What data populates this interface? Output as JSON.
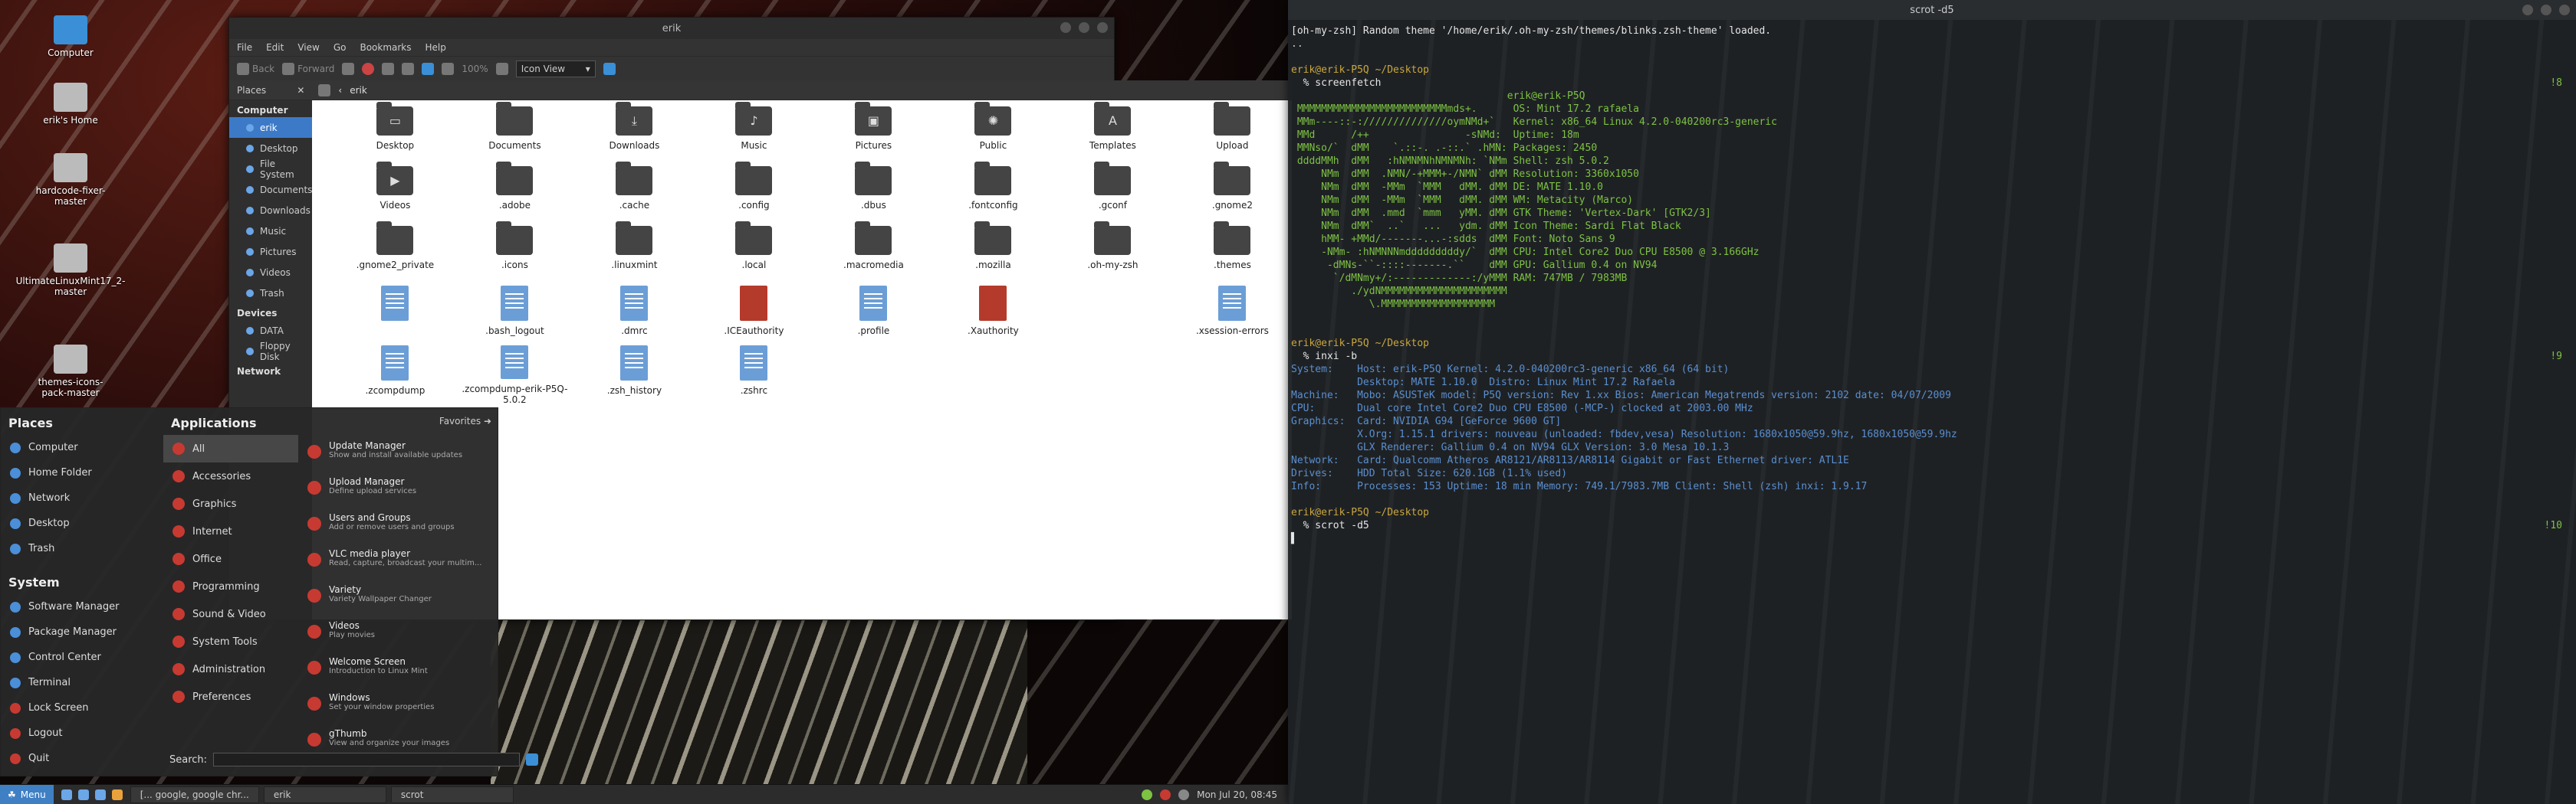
{
  "desktop_icons": [
    {
      "label": "Computer",
      "icon": "monitor-icon"
    },
    {
      "label": "erik's Home",
      "icon": "home-icon"
    },
    {
      "label": "hardcode-fixer-master",
      "icon": "drive-icon"
    },
    {
      "label": "UltimateLinuxMint17_2-master",
      "icon": "drive-icon"
    },
    {
      "label": "themes-icons-pack-master",
      "icon": "drive-icon"
    }
  ],
  "fm": {
    "title": "erik",
    "menu": [
      "File",
      "Edit",
      "View",
      "Go",
      "Bookmarks",
      "Help"
    ],
    "back": "Back",
    "forward": "Forward",
    "zoom": "100%",
    "view_mode": "Icon View",
    "places_label": "Places",
    "path_label": "erik",
    "sidebar": {
      "computer_label": "Computer",
      "computer": [
        "erik",
        "Desktop",
        "File System",
        "Documents",
        "Downloads",
        "Music",
        "Pictures",
        "Videos",
        "Trash"
      ],
      "devices_label": "Devices",
      "devices": [
        "DATA",
        "Floppy Disk"
      ],
      "network_label": "Network"
    },
    "files": [
      {
        "name": "Desktop",
        "kind": "folder",
        "glyph": "▭"
      },
      {
        "name": "Documents",
        "kind": "folder",
        "glyph": ""
      },
      {
        "name": "Downloads",
        "kind": "folder",
        "glyph": "⤓"
      },
      {
        "name": "Music",
        "kind": "folder",
        "glyph": "♪"
      },
      {
        "name": "Pictures",
        "kind": "folder",
        "glyph": "▣"
      },
      {
        "name": "Public",
        "kind": "folder",
        "glyph": "✺"
      },
      {
        "name": "Templates",
        "kind": "folder",
        "glyph": "A"
      },
      {
        "name": "Upload",
        "kind": "folder",
        "glyph": ""
      },
      {
        "name": "Videos",
        "kind": "folder",
        "glyph": "▶"
      },
      {
        "name": ".adobe",
        "kind": "folder",
        "glyph": ""
      },
      {
        "name": ".cache",
        "kind": "folder",
        "glyph": ""
      },
      {
        "name": ".config",
        "kind": "folder",
        "glyph": ""
      },
      {
        "name": ".dbus",
        "kind": "folder",
        "glyph": ""
      },
      {
        "name": ".fontconfig",
        "kind": "folder",
        "glyph": ""
      },
      {
        "name": ".gconf",
        "kind": "folder",
        "glyph": ""
      },
      {
        "name": ".gnome2",
        "kind": "folder",
        "glyph": ""
      },
      {
        "name": ".gnome2_private",
        "kind": "folder",
        "glyph": ""
      },
      {
        "name": ".icons",
        "kind": "folder",
        "glyph": ""
      },
      {
        "name": ".linuxmint",
        "kind": "folder",
        "glyph": ""
      },
      {
        "name": ".local",
        "kind": "folder",
        "glyph": ""
      },
      {
        "name": ".macromedia",
        "kind": "folder",
        "glyph": ""
      },
      {
        "name": ".mozilla",
        "kind": "folder",
        "glyph": ""
      },
      {
        "name": ".oh-my-zsh",
        "kind": "folder",
        "glyph": ""
      },
      {
        "name": ".themes",
        "kind": "folder",
        "glyph": ""
      },
      {
        "name": "",
        "kind": "doc",
        "glyph": ""
      },
      {
        "name": ".bash_logout",
        "kind": "doc",
        "glyph": ""
      },
      {
        "name": ".dmrc",
        "kind": "doc",
        "glyph": ""
      },
      {
        "name": ".ICEauthority",
        "kind": "doc-red",
        "glyph": ""
      },
      {
        "name": ".profile",
        "kind": "doc",
        "glyph": ""
      },
      {
        "name": ".Xauthority",
        "kind": "doc-red",
        "glyph": ""
      },
      {
        "name": "",
        "kind": "blank",
        "glyph": ""
      },
      {
        "name": ".xsession-errors",
        "kind": "doc",
        "glyph": ""
      },
      {
        "name": ".zcompdump",
        "kind": "doc",
        "glyph": ""
      },
      {
        "name": ".zcompdump-erik-P5Q-5.0.2",
        "kind": "doc",
        "glyph": ""
      },
      {
        "name": ".zsh_history",
        "kind": "doc",
        "glyph": ""
      },
      {
        "name": ".zshrc",
        "kind": "doc",
        "glyph": ""
      }
    ]
  },
  "menu": {
    "places_title": "Places",
    "places": [
      "Computer",
      "Home Folder",
      "Network",
      "Desktop",
      "Trash"
    ],
    "system_title": "System",
    "system": [
      "Software Manager",
      "Package Manager",
      "Control Center",
      "Terminal",
      "Lock Screen",
      "Logout",
      "Quit"
    ],
    "apps_title": "Applications",
    "favorites": "Favorites",
    "categories": [
      "All",
      "Accessories",
      "Graphics",
      "Internet",
      "Office",
      "Programming",
      "Sound & Video",
      "System Tools",
      "Administration",
      "Preferences"
    ],
    "apps": [
      {
        "name": "Update Manager",
        "desc": "Show and install available updates"
      },
      {
        "name": "Upload Manager",
        "desc": "Define upload services"
      },
      {
        "name": "Users and Groups",
        "desc": "Add or remove users and groups"
      },
      {
        "name": "VLC media player",
        "desc": "Read, capture, broadcast your multim..."
      },
      {
        "name": "Variety",
        "desc": "Variety Wallpaper Changer"
      },
      {
        "name": "Videos",
        "desc": "Play movies"
      },
      {
        "name": "Welcome Screen",
        "desc": "Introduction to Linux Mint"
      },
      {
        "name": "Windows",
        "desc": "Set your window properties"
      },
      {
        "name": "gThumb",
        "desc": "View and organize your images"
      }
    ],
    "search_label": "Search:"
  },
  "panel": {
    "menu_label": "Menu",
    "tasks": [
      "[... google, google chr...",
      "erik",
      "scrot"
    ],
    "clock": "Mon Jul 20, 08:45"
  },
  "term": {
    "title": "scrot -d5",
    "lines": [
      {
        "t": "[oh-my-zsh] Random theme '/home/erik/.oh-my-zsh/themes/blinks.zsh-theme' loaded.",
        "cls": "w"
      },
      {
        "t": "..",
        "cls": ""
      },
      {
        "t": "",
        "cls": ""
      },
      {
        "t": "erik@erik-P5Q ~/Desktop",
        "cls": "y",
        "rt": ""
      },
      {
        "t": "  % screenfetch",
        "cls": "w",
        "rt": "!8"
      },
      {
        "t": "                                    erik@erik-P5Q",
        "cls": "g"
      },
      {
        "t": " MMMMMMMMMMMMMMMMMMMMMMMMMmds+.      OS: Mint 17.2 rafaela",
        "cls": "g"
      },
      {
        "t": " MMm----::-://////////////oymNMd+`   Kernel: x86_64 Linux 4.2.0-040200rc3-generic",
        "cls": "g"
      },
      {
        "t": " MMd      /++                -sNMd:  Uptime: 18m",
        "cls": "g"
      },
      {
        "t": " MMNso/`  dMM    `.::-. .-::.` .hMN: Packages: 2450",
        "cls": "g"
      },
      {
        "t": " ddddMMh  dMM   :hNMNMNhNMNMNh: `NMm Shell: zsh 5.0.2",
        "cls": "g"
      },
      {
        "t": "     NMm  dMM  .NMN/-+MMM+-/NMN` dMM Resolution: 3360x1050",
        "cls": "g"
      },
      {
        "t": "     NMm  dMM  -MMm  `MMM   dMM. dMM DE: MATE 1.10.0",
        "cls": "g"
      },
      {
        "t": "     NMm  dMM  -MMm  `MMM   dMM. dMM WM: Metacity (Marco)",
        "cls": "g"
      },
      {
        "t": "     NMm  dMM  .mmd  `mmm   yMM. dMM GTK Theme: 'Vertex-Dark' [GTK2/3]",
        "cls": "g"
      },
      {
        "t": "     NMm  dMM`  ..`   ...   ydm. dMM Icon Theme: Sardi Flat Black",
        "cls": "g"
      },
      {
        "t": "     hMM- +MMd/-------...-:sdds  dMM Font: Noto Sans 9",
        "cls": "g"
      },
      {
        "t": "     -NMm- :hNMNNNmdddddddddy/`  dMM CPU: Intel Core2 Duo CPU E8500 @ 3.166GHz",
        "cls": "g"
      },
      {
        "t": "      -dMNs-``-::::-------.``    dMM GPU: Gallium 0.4 on NV94",
        "cls": "g"
      },
      {
        "t": "       `/dMNmy+/:-------------:/yMMM RAM: 747MB / 7983MB",
        "cls": "g"
      },
      {
        "t": "          ./ydNMMMMMMMMMMMMMMMMMMMMM",
        "cls": "g"
      },
      {
        "t": "             \\.MMMMMMMMMMMMMMMMMMM",
        "cls": "g"
      },
      {
        "t": "",
        "cls": ""
      },
      {
        "t": "",
        "cls": ""
      },
      {
        "t": "erik@erik-P5Q ~/Desktop",
        "cls": "y"
      },
      {
        "t": "  % inxi -b",
        "cls": "w",
        "rt": "!9"
      },
      {
        "t": "System:    Host: erik-P5Q Kernel: 4.2.0-040200rc3-generic x86_64 (64 bit)",
        "cls": "b"
      },
      {
        "t": "           Desktop: MATE 1.10.0  Distro: Linux Mint 17.2 Rafaela",
        "cls": "b"
      },
      {
        "t": "Machine:   Mobo: ASUSTeK model: P5Q version: Rev 1.xx Bios: American Megatrends version: 2102 date: 04/07/2009",
        "cls": "b"
      },
      {
        "t": "CPU:       Dual core Intel Core2 Duo CPU E8500 (-MCP-) clocked at 2003.00 MHz",
        "cls": "b"
      },
      {
        "t": "Graphics:  Card: NVIDIA G94 [GeForce 9600 GT]",
        "cls": "b"
      },
      {
        "t": "           X.Org: 1.15.1 drivers: nouveau (unloaded: fbdev,vesa) Resolution: 1680x1050@59.9hz, 1680x1050@59.9hz",
        "cls": "b"
      },
      {
        "t": "           GLX Renderer: Gallium 0.4 on NV94 GLX Version: 3.0 Mesa 10.1.3",
        "cls": "b"
      },
      {
        "t": "Network:   Card: Qualcomm Atheros AR8121/AR8113/AR8114 Gigabit or Fast Ethernet driver: ATL1E",
        "cls": "b"
      },
      {
        "t": "Drives:    HDD Total Size: 620.1GB (1.1% used)",
        "cls": "b"
      },
      {
        "t": "Info:      Processes: 153 Uptime: 18 min Memory: 749.1/7983.7MB Client: Shell (zsh) inxi: 1.9.17",
        "cls": "b"
      },
      {
        "t": "",
        "cls": ""
      },
      {
        "t": "erik@erik-P5Q ~/Desktop",
        "cls": "y"
      },
      {
        "t": "  % scrot -d5",
        "cls": "w",
        "rt": "!10"
      },
      {
        "t": "▌",
        "cls": "w"
      }
    ]
  }
}
